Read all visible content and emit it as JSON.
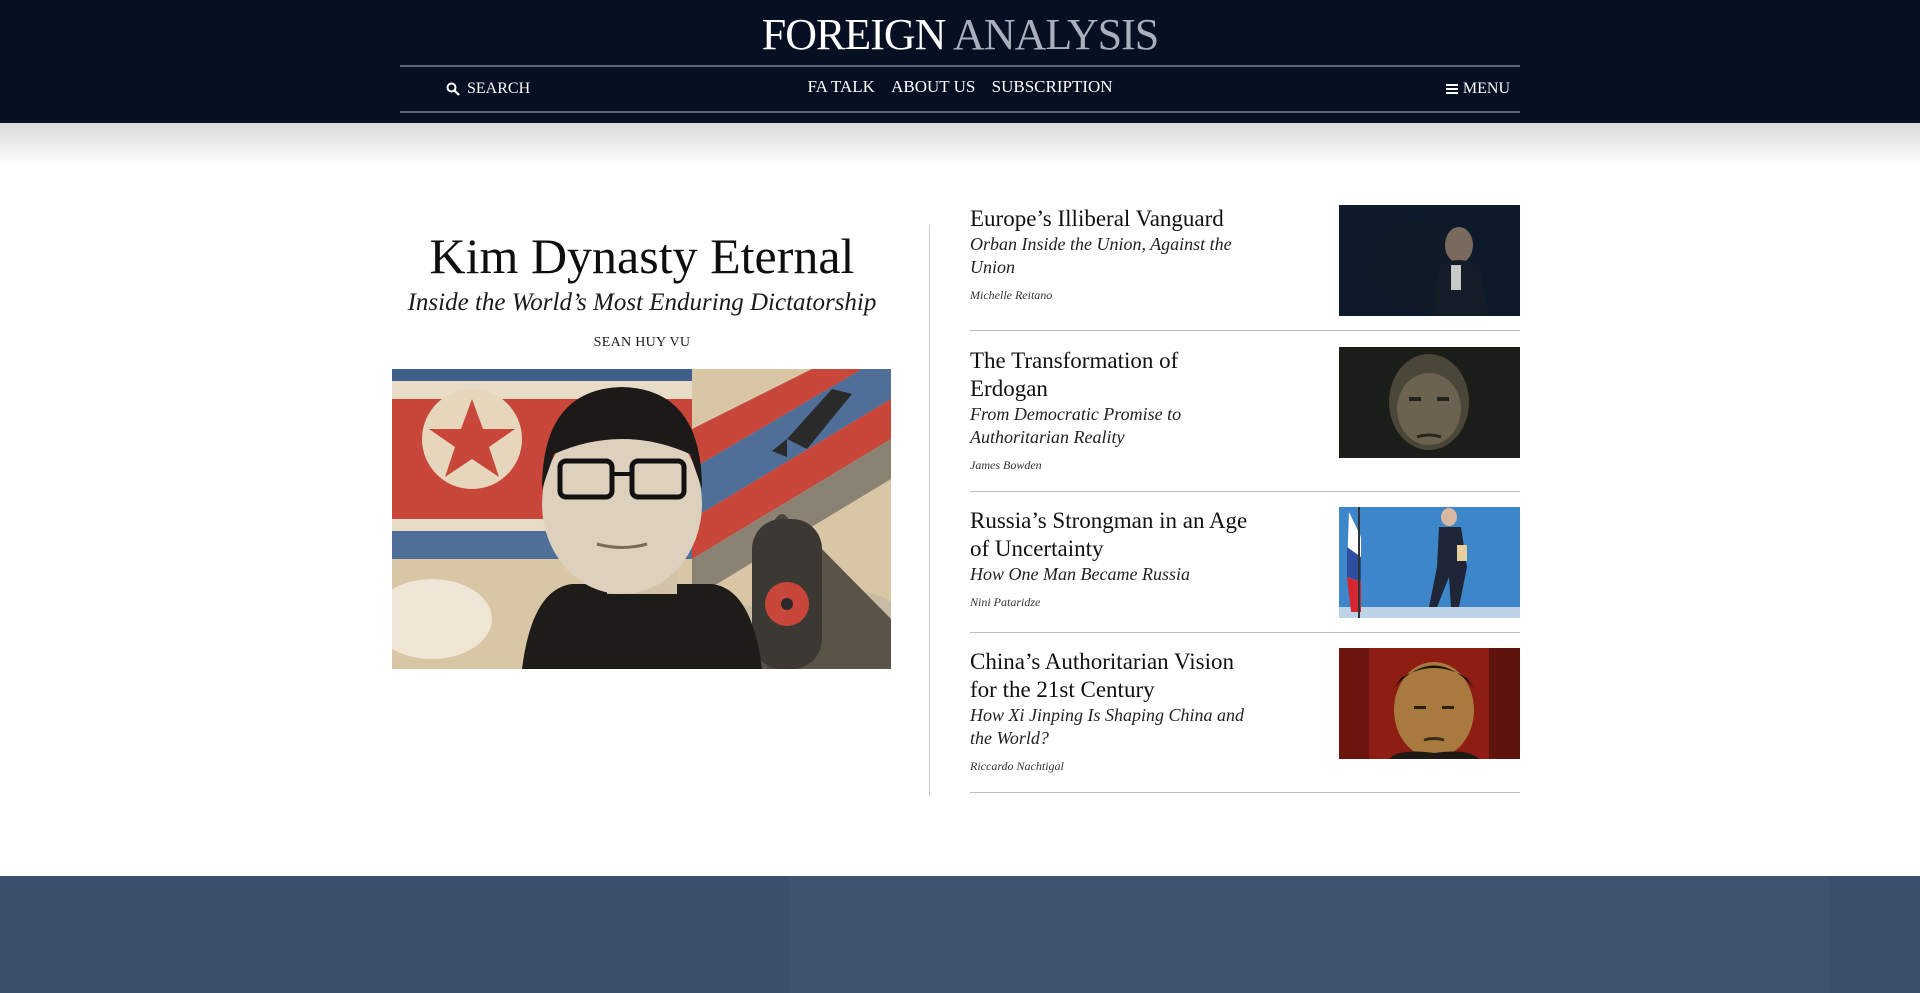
{
  "site": {
    "logo_part1": "FOREIGN",
    "logo_part2": "ANALYSIS"
  },
  "nav": {
    "search_label": "SEARCH",
    "links": [
      "FA TALK",
      "ABOUT US",
      "SUBSCRIPTION"
    ],
    "menu_label": "MENU"
  },
  "feature": {
    "title": "Kim Dynasty Eternal",
    "subtitle": "Inside the World’s Most Enduring Dictatorship",
    "author": "SEAN HUY VU"
  },
  "articles": [
    {
      "title": "Europe’s Illiberal Vanguard",
      "subtitle": "Orban Inside the Union, Against the Union",
      "author": "Michelle Reitano"
    },
    {
      "title": "The Transformation of Erdogan",
      "subtitle": "From Democratic Promise to Authoritarian Reality",
      "author": "James Bowden"
    },
    {
      "title": "Russia’s Strongman in an Age of Uncertainty",
      "subtitle": "How One Man Became Russia",
      "author": "Nini Pataridze"
    },
    {
      "title": "China’s Authoritarian Vision for the 21st Century",
      "subtitle": "How Xi Jinping Is Shaping China and the World?",
      "author": "Riccardo Nachtigal"
    }
  ],
  "colors": {
    "header_bg": "#070f23",
    "footer_bg": "#38506b",
    "divider": "#bdbdbd"
  },
  "icons": {
    "search": "search-icon",
    "menu": "hamburger-menu-icon"
  }
}
